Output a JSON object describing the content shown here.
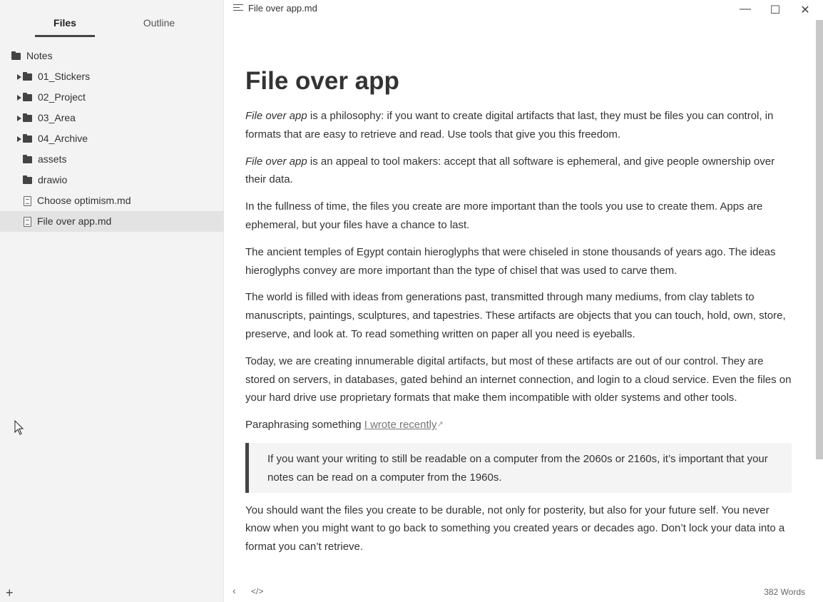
{
  "sidebar": {
    "tabs": [
      {
        "label": "Files"
      },
      {
        "label": "Outline"
      }
    ],
    "root": {
      "label": "Notes"
    },
    "items": [
      {
        "label": "01_Stickers"
      },
      {
        "label": "02_Project"
      },
      {
        "label": "03_Area"
      },
      {
        "label": "04_Archive"
      },
      {
        "label": "assets"
      },
      {
        "label": "drawio"
      },
      {
        "label": "Choose optimism.md"
      },
      {
        "label": "File over app.md"
      }
    ],
    "add_label": "+"
  },
  "titlebar": {
    "title": "File over app.md",
    "minimize": "—",
    "maximize": "☐",
    "close": "✕"
  },
  "doc": {
    "heading": "File over app",
    "p1_em": "File over app",
    "p1_rest": " is a philosophy: if you want to create digital artifacts that last, they must be files you can control, in formats  that are easy to retrieve and read. Use tools that give you this  freedom.",
    "p2_em": "File over app",
    "p2_rest": " is an appeal to tool makers: accept that all software is ephemeral, and give people ownership over their data.",
    "p3": "In the fullness of time, the files you create are more important than the tools you use to create them. Apps are ephemeral, but your files  have a chance to last.",
    "p4": "The ancient temples of Egypt contain hieroglyphs that were chiseled  in stone thousands of years ago. The ideas hieroglyphs convey are more  important than the type of chisel that was used to carve them.",
    "p5": "The world is filled with ideas from generations past, transmitted  through many mediums, from clay tablets to manuscripts, paintings,  sculptures, and tapestries. These artifacts are objects that you can  touch, hold, own, store, preserve, and look at. To read something  written on paper all you need is eyeballs.",
    "p6": "Today, we are creating innumerable digital artifacts, but most of  these artifacts are out of our control. They are stored on servers, in  databases, gated behind an internet connection, and login to a cloud  service. Even the files on your hard drive use proprietary formats that  make them incompatible with older systems and other tools.",
    "p7_text": "Paraphrasing something ",
    "p7_link": "I wrote recently",
    "p7_ext": "↗",
    "quote": "If you want your writing to still be readable on a computer from  the 2060s or 2160s, it’s important that your notes can be read on a  computer from the 1960s.",
    "p8": "You should want the files you create to be durable, not only for  posterity, but also for your future self. You never know when you might  want to go back to something you created years or decades ago. Don’t  lock your data into a format you can’t retrieve."
  },
  "footer": {
    "back": "‹",
    "source": "</>",
    "wordcount": "382 Words"
  }
}
